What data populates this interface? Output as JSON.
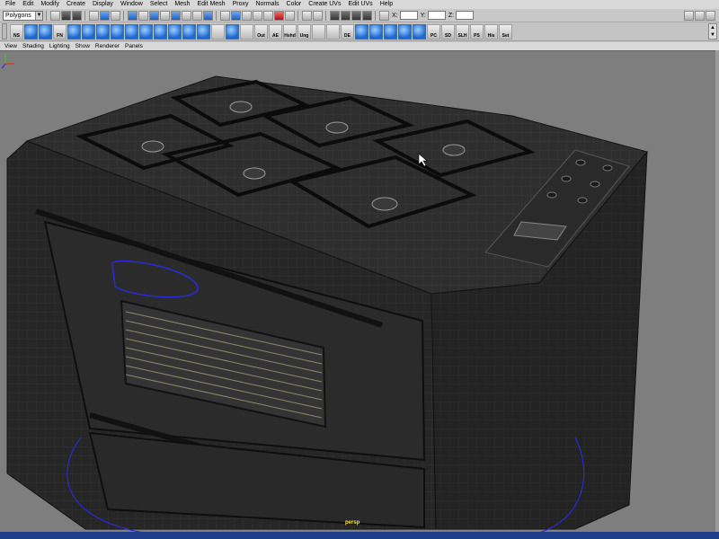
{
  "menu": [
    "File",
    "Edit",
    "Modify",
    "Create",
    "Display",
    "Window",
    "Select",
    "Mesh",
    "Edit Mesh",
    "Proxy",
    "Normals",
    "Color",
    "Create UVs",
    "Edit UVs",
    "Help"
  ],
  "status_line": {
    "mode": "Polygons",
    "coord_labels": [
      "X:",
      "Y:",
      "Z:"
    ]
  },
  "shelf": {
    "labels": [
      "NS",
      "FN",
      "Out",
      "AE",
      "Hshd",
      "Ung",
      "DE",
      "PC",
      "SD",
      "SLH",
      "PS",
      "His",
      "Set"
    ]
  },
  "panel_menu": [
    "View",
    "Shading",
    "Lighting",
    "Show",
    "Renderer",
    "Panels"
  ],
  "viewport": {
    "camera": "persp"
  },
  "colors": {
    "viewport_bg": "#7e7e7e",
    "accent_blue": "#1e3d8a",
    "camera_label": "#ffe04a"
  }
}
